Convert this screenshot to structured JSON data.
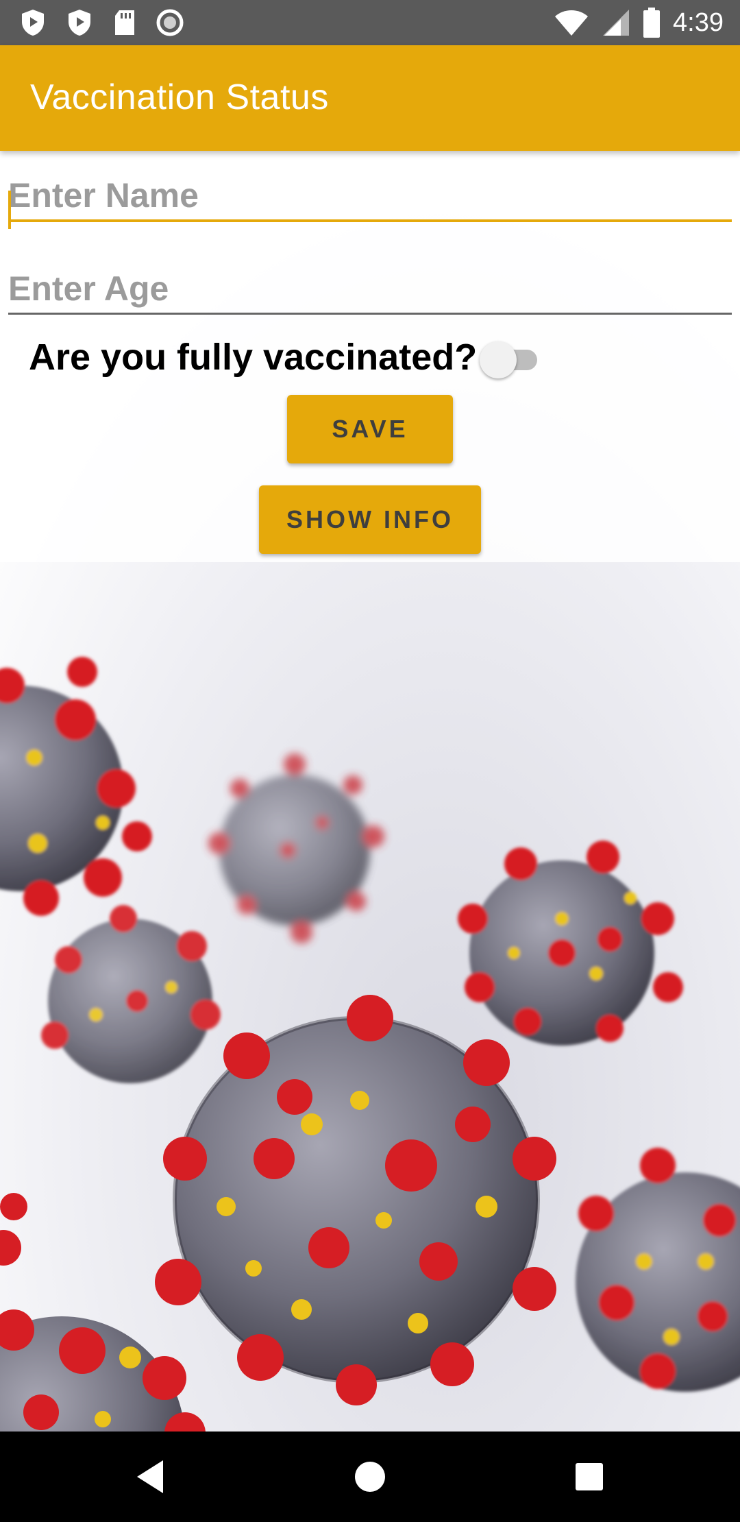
{
  "status_bar": {
    "time": "4:39",
    "icons": [
      "shield-icon",
      "play-protect-icon",
      "sd-card-icon",
      "record-icon",
      "wifi-icon",
      "signal-icon",
      "battery-icon"
    ]
  },
  "app_bar": {
    "title": "Vaccination Status",
    "color": "#e5a90b"
  },
  "form": {
    "name_placeholder": "Enter Name",
    "age_placeholder": "Enter Age",
    "question": "Are you fully vaccinated?",
    "switch_on": false,
    "save_label": "SAVE",
    "info_label": "SHOW INFO"
  },
  "background": {
    "description_icon": "coronavirus-illustration"
  },
  "nav_bar": {
    "icons": [
      "back-icon",
      "home-icon",
      "recents-icon"
    ]
  }
}
